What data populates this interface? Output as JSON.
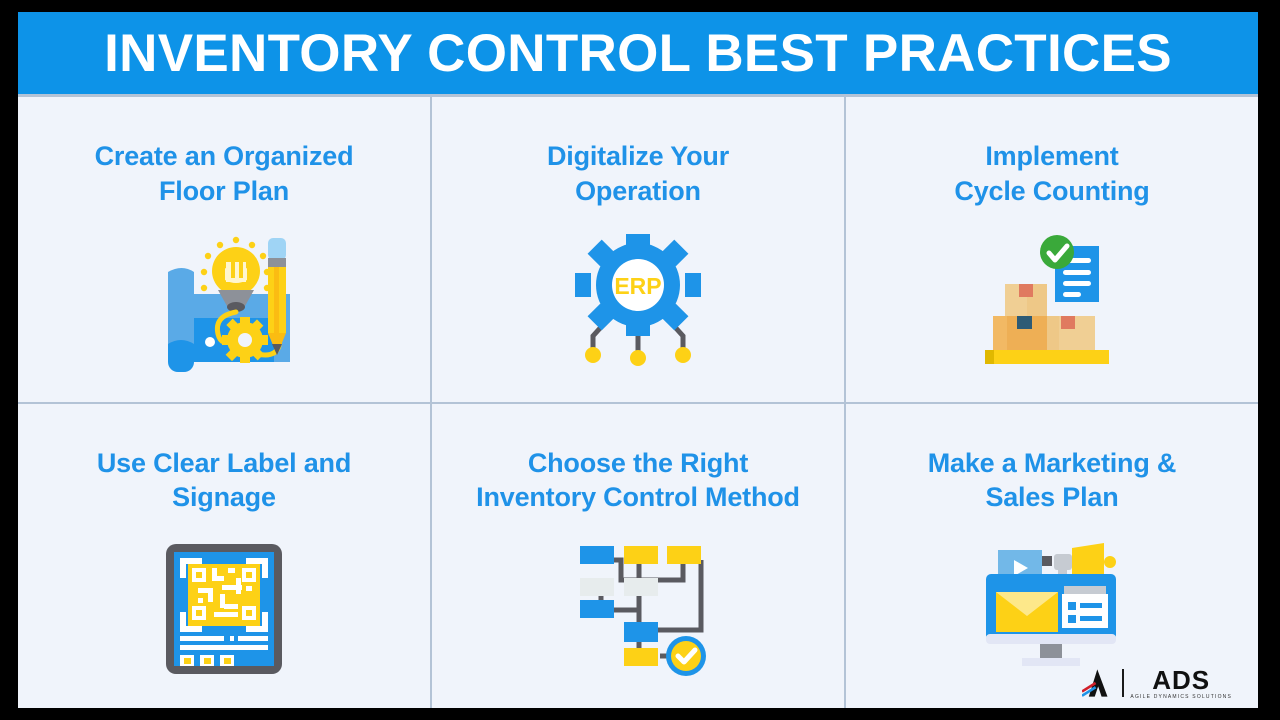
{
  "header": {
    "title": "INVENTORY CONTROL BEST PRACTICES",
    "background_color": "#0d93e8",
    "text_color": "#ffffff"
  },
  "theme": {
    "page_background": "#f0f4fb",
    "frame_border_color": "#000000",
    "grid_line_color": "#b3c3d6",
    "title_blue": "#1f92e8",
    "accent_blue": "#0d93e8",
    "accent_yellow": "#fdd116",
    "accent_green": "#3aa93a",
    "accent_gray": "#5a5a60"
  },
  "cells": [
    {
      "title": "Create an Organized\nFloor Plan",
      "title_line1": "Create an Organized",
      "title_line2": "Floor Plan",
      "icon_name": "blueprint-lightbulb-pencil-icon"
    },
    {
      "title": "Digitalize Your\nOperation",
      "title_line1": "Digitalize Your",
      "title_line2": "Operation",
      "icon_name": "erp-gear-icon",
      "icon_label": "ERP"
    },
    {
      "title": "Implement\nCycle Counting",
      "title_line1": "Implement",
      "title_line2": "Cycle Counting",
      "icon_name": "boxes-checklist-icon"
    },
    {
      "title": "Use Clear Label and\nSignage",
      "title_line1": "Use Clear Label and",
      "title_line2": "Signage",
      "icon_name": "qr-code-scanner-icon"
    },
    {
      "title": "Choose the Right\nInventory Control Method",
      "title_line1": "Choose the Right",
      "title_line2": "Inventory Control Method",
      "icon_name": "flowchart-check-icon"
    },
    {
      "title": "Make a Marketing &\nSales Plan",
      "title_line1": "Make a Marketing &",
      "title_line2": "Sales Plan",
      "icon_name": "monitor-megaphone-marketing-icon"
    }
  ],
  "logo": {
    "wordmark": "ADS",
    "tagline": "AGILE DYNAMICS SOLUTIONS"
  }
}
